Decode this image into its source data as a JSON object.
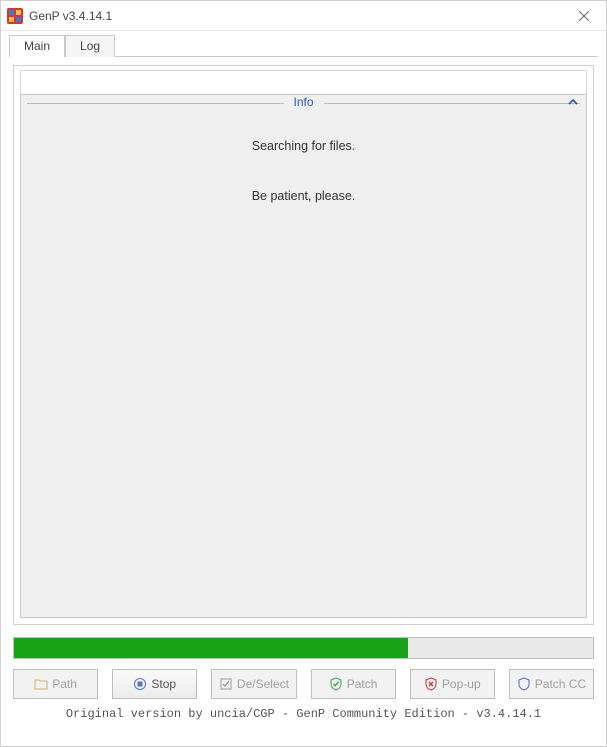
{
  "window": {
    "title": "GenP v3.4.14.1"
  },
  "tabs": {
    "main": "Main",
    "log": "Log",
    "active": "main"
  },
  "info": {
    "caption": "Info",
    "line1": "Searching for files.",
    "line2": "Be patient, please."
  },
  "progress": {
    "percent": 68
  },
  "buttons": {
    "path": "Path",
    "stop": "Stop",
    "deselect": "De/Select",
    "patch": "Patch",
    "popup": "Pop-up",
    "patch_cc": "Patch CC"
  },
  "footer": {
    "text": "Original version by uncia/CGP - GenP Community Edition - v3.4.14.1"
  },
  "colors": {
    "progress_fill": "#18a318",
    "link": "#2a54c4"
  }
}
